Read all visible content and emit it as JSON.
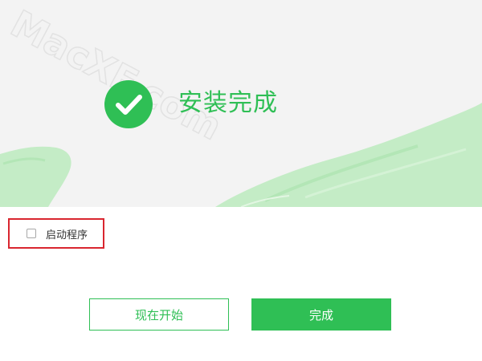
{
  "window": {
    "title": "安装完成",
    "watermark": "MacXF.com"
  },
  "icons": {
    "status": "check-circle-icon"
  },
  "options": {
    "launch_label": "启动程序",
    "launch_checked": false
  },
  "buttons": {
    "start_label": "现在开始",
    "done_label": "完成"
  },
  "colors": {
    "accent": "#2fbf55",
    "highlight_box": "#d9262f",
    "hero_background": "#f3f3f3",
    "brush": "#c4ecc6"
  }
}
